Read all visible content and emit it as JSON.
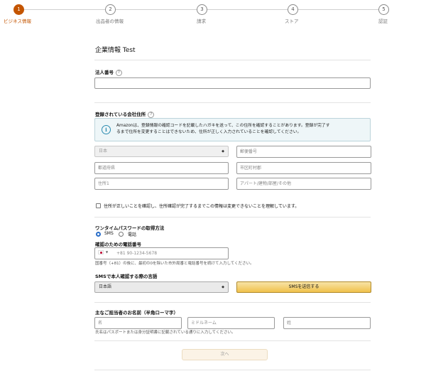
{
  "stepper": {
    "steps": [
      {
        "num": "1",
        "label": "ビジネス情報"
      },
      {
        "num": "2",
        "label": "出品者の情報"
      },
      {
        "num": "3",
        "label": "請求"
      },
      {
        "num": "4",
        "label": "ストア"
      },
      {
        "num": "5",
        "label": "認証"
      }
    ]
  },
  "page_title": "企業情報 Test",
  "corp_number": {
    "label": "法人番号"
  },
  "address": {
    "label": "登録されている会社住所",
    "info_line1": "Amazonは、登録情報の確認コードを記載したハガキを送って、この住所を確認することがあります。登録が完了す",
    "info_line2": "るまで住所を変更することはできないため、住所が正しく入力されていることを確認してください。",
    "country_value": "日本",
    "postal_placeholder": "郵便番号",
    "prefecture_placeholder": "都道府県",
    "city_placeholder": "市区町村郡",
    "address1_placeholder": "住所1",
    "address2_placeholder": "アパート/建物/部屋/その他",
    "confirm_text": "住所が正しいことを確認し、住所確認が完了するまでこの情報は変更できないことを理解しています。"
  },
  "otp": {
    "label": "ワンタイムパスワードの取得方法",
    "option_sms": "SMS",
    "option_phone": "電話",
    "phone_label": "確認のための電話番号",
    "phone_placeholder": "+81 90-1234-5678",
    "phone_note": "国番号（+81）の後に、最初の0を除いた市外局番と電話番号を続けて入力してください。"
  },
  "sms_language": {
    "label": "SMSで本人確認する際の言語",
    "value": "日本語",
    "button": "SMSを送信する"
  },
  "name": {
    "label": "主なご担当者のお名前（半角ローマ字）",
    "first_placeholder": "名",
    "middle_placeholder": "ミドルネーム",
    "last_placeholder": "姓",
    "note": "氏名はパスポートまたは身分証明書に記載されている通りに入力してください。"
  },
  "next_button": "次へ",
  "colors": {
    "accent": "#c45500",
    "button": "#f0c14b",
    "info_bg": "#eef6f8"
  }
}
